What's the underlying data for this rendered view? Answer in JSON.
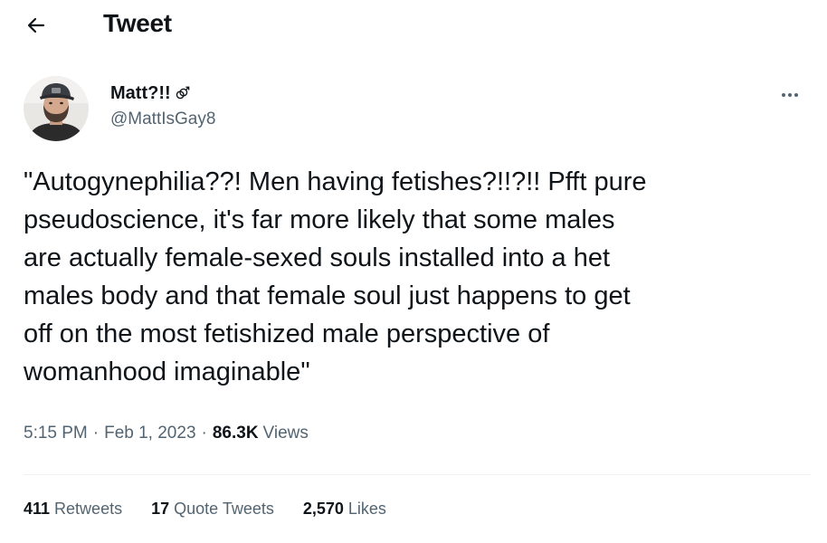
{
  "header": {
    "title": "Tweet",
    "back_icon": "arrow-left-icon"
  },
  "author": {
    "display_name": "Matt?!!",
    "name_glyph": "double-male-symbol-icon",
    "handle": "@MattIsGay8",
    "avatar_icon": "user-avatar-photo",
    "more_icon": "ellipsis-icon"
  },
  "tweet": {
    "text": "\"Autogynephilia??! Men having fetishes?!!?!! Pfft pure\npseudoscience, it's far more likely that some males\nare actually female-sexed souls installed into a het\nmales body and that female soul just happens to get\noff on the most fetishized male perspective of\nwomanhood imaginable\""
  },
  "meta": {
    "time": "5:15 PM",
    "separator": "·",
    "date": "Feb 1, 2023",
    "views_count": "86.3K",
    "views_label": "Views"
  },
  "stats": {
    "retweets_count": "411",
    "retweets_label": "Retweets",
    "quotes_count": "17",
    "quotes_label": "Quote Tweets",
    "likes_count": "2,570",
    "likes_label": "Likes"
  },
  "colors": {
    "text_primary": "#0f1419",
    "text_secondary": "#536471",
    "divider": "#eff3f4",
    "background": "#ffffff"
  }
}
